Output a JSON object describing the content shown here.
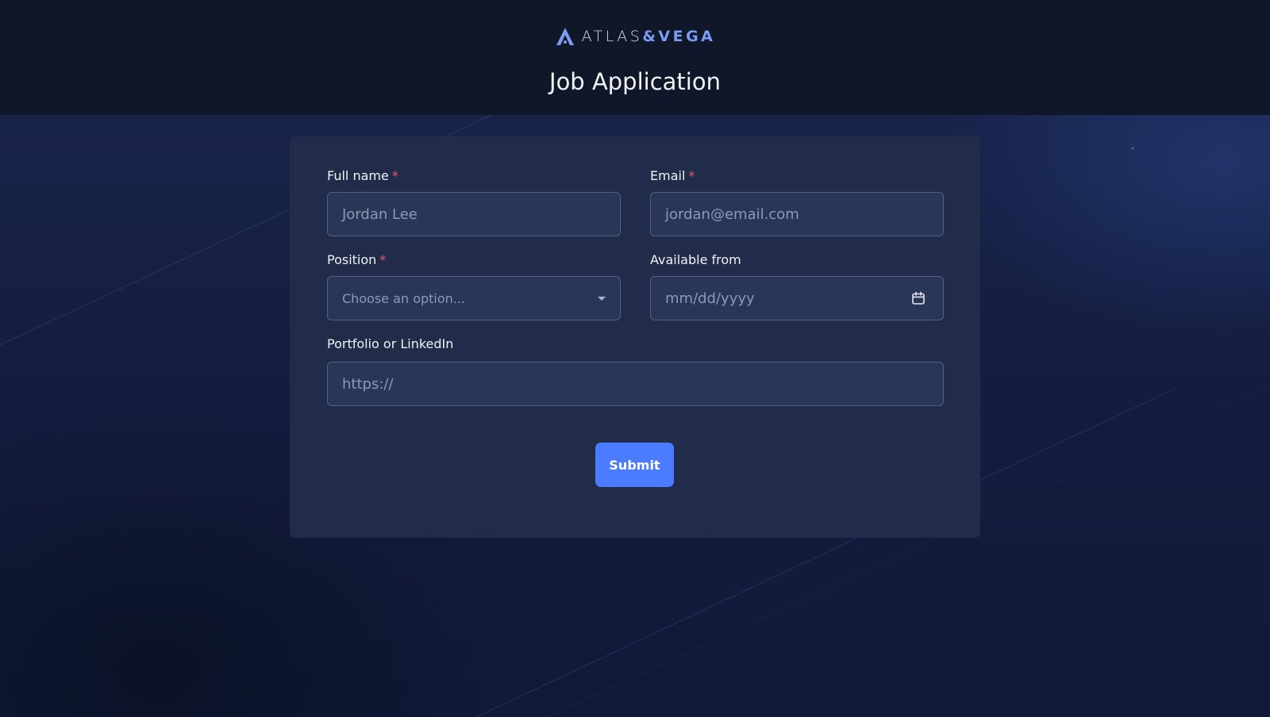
{
  "brand": {
    "name_part1": "ATLAS",
    "name_part2": "&VEGA",
    "logo_icon": "a-triangle-logo-icon"
  },
  "page": {
    "title": "Job Application"
  },
  "form": {
    "full_name": {
      "label": "Full name",
      "required_mark": "*",
      "placeholder": "Jordan Lee"
    },
    "email": {
      "label": "Email",
      "required_mark": "*",
      "placeholder": "jordan@email.com"
    },
    "position": {
      "label": "Position",
      "required_mark": "*",
      "selected": "Choose an option...",
      "icon": "caret-down-icon"
    },
    "available_from": {
      "label": "Available from",
      "placeholder": "mm/dd/yyyy",
      "icon": "calendar-icon"
    },
    "portfolio": {
      "label": "Portfolio or LinkedIn",
      "placeholder": "https://"
    },
    "submit_label": "Submit"
  },
  "colors": {
    "header_bg": "#101729",
    "page_bg": "#141e40",
    "card_bg": "#212b4a",
    "input_bg": "#2a3658",
    "accent": "#4b7bff",
    "brand_accent": "#7c9cf2",
    "required": "#ef5a6f"
  }
}
